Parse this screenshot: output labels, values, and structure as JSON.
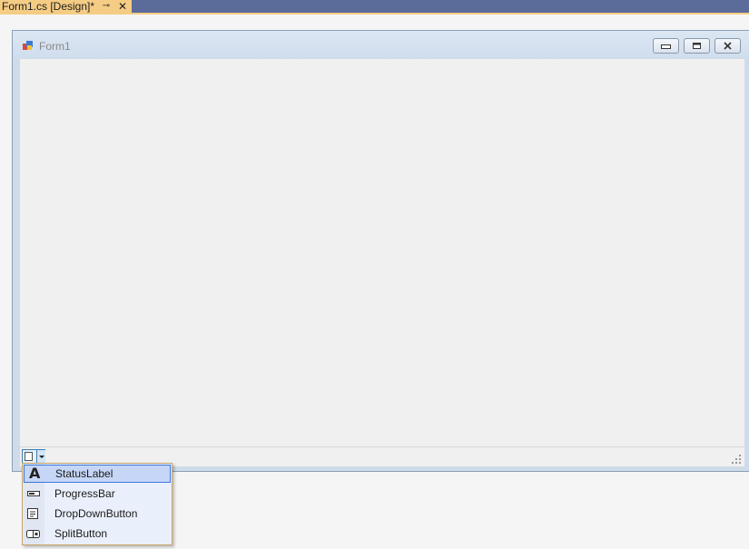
{
  "document_tab": {
    "title": "Form1.cs [Design]*",
    "pin_icon": "pin-icon",
    "close_icon": "close-icon"
  },
  "form": {
    "title": "Form1",
    "icon": "form-icon"
  },
  "window_buttons": [
    "minimize",
    "maximize",
    "close"
  ],
  "status_strip": {
    "add_item_button": "add-item-dropdown",
    "grip": "size-grip-icon"
  },
  "add_menu": {
    "items": [
      {
        "label": "StatusLabel",
        "icon": "status-label-icon",
        "highlighted": true
      },
      {
        "label": "ProgressBar",
        "icon": "progress-bar-icon",
        "highlighted": false
      },
      {
        "label": "DropDownButton",
        "icon": "dropdown-button-icon",
        "highlighted": false
      },
      {
        "label": "SplitButton",
        "icon": "split-button-icon",
        "highlighted": false
      }
    ]
  },
  "colors": {
    "tab_active": "#f5cc84",
    "tabstrip": "#5b6b9a",
    "menu_highlight": "#c6d6f7"
  }
}
